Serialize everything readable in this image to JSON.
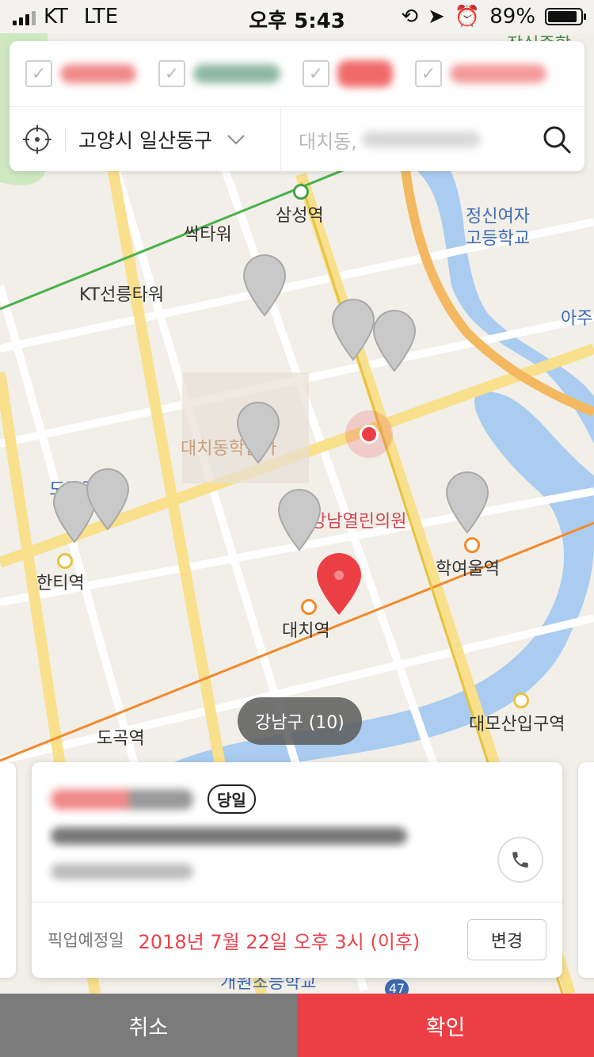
{
  "status_bar": {
    "carrier": "KT",
    "network": "LTE",
    "time": "오후 5:43",
    "battery": "89%",
    "battery_level": 0.89
  },
  "map": {
    "labels": {
      "samseong": "삼성역",
      "ssak_tower": "싹타워",
      "kt_tower": "KT선릉타워",
      "girls_school": "정신여자\n고등학교",
      "daechi_academy": "대치동학원가",
      "clinic": "강남열린의원",
      "hakyeoul": "학여울역",
      "hanti": "한티역",
      "daechi_station": "대치역",
      "dogok": "도곡역",
      "daemo": "대모산입구역",
      "aju": "아주",
      "jamsil_top": "잠실종합",
      "dogok_school": "도곡중학교",
      "bottom_school": "개원초등학교",
      "route_47": "47"
    },
    "district_badge": "강남구 (10)"
  },
  "filter": {
    "items": [
      {
        "label": "Blurred A",
        "color": "#f08a8a"
      },
      {
        "label": "Blurred B",
        "color": "#8fb8a4"
      },
      {
        "label": "Blurred C",
        "color": "#f06a6a"
      },
      {
        "label": "Blurred D",
        "color": "#f49a9a"
      }
    ],
    "region": "고양시 일산동구",
    "search_placeholder": "대치동,"
  },
  "card": {
    "name": "Blurred shop",
    "badge": "당일",
    "address": "Blurred address",
    "phone": "Blurred phone",
    "pickup_label": "픽업예정일",
    "pickup_date": "2018년 7월 22일 오후 3시 (이후)",
    "change_label": "변경"
  },
  "buttons": {
    "cancel": "취소",
    "confirm": "확인"
  },
  "colors": {
    "accent": "#ec3f45",
    "cancel": "#7b7b7b"
  }
}
